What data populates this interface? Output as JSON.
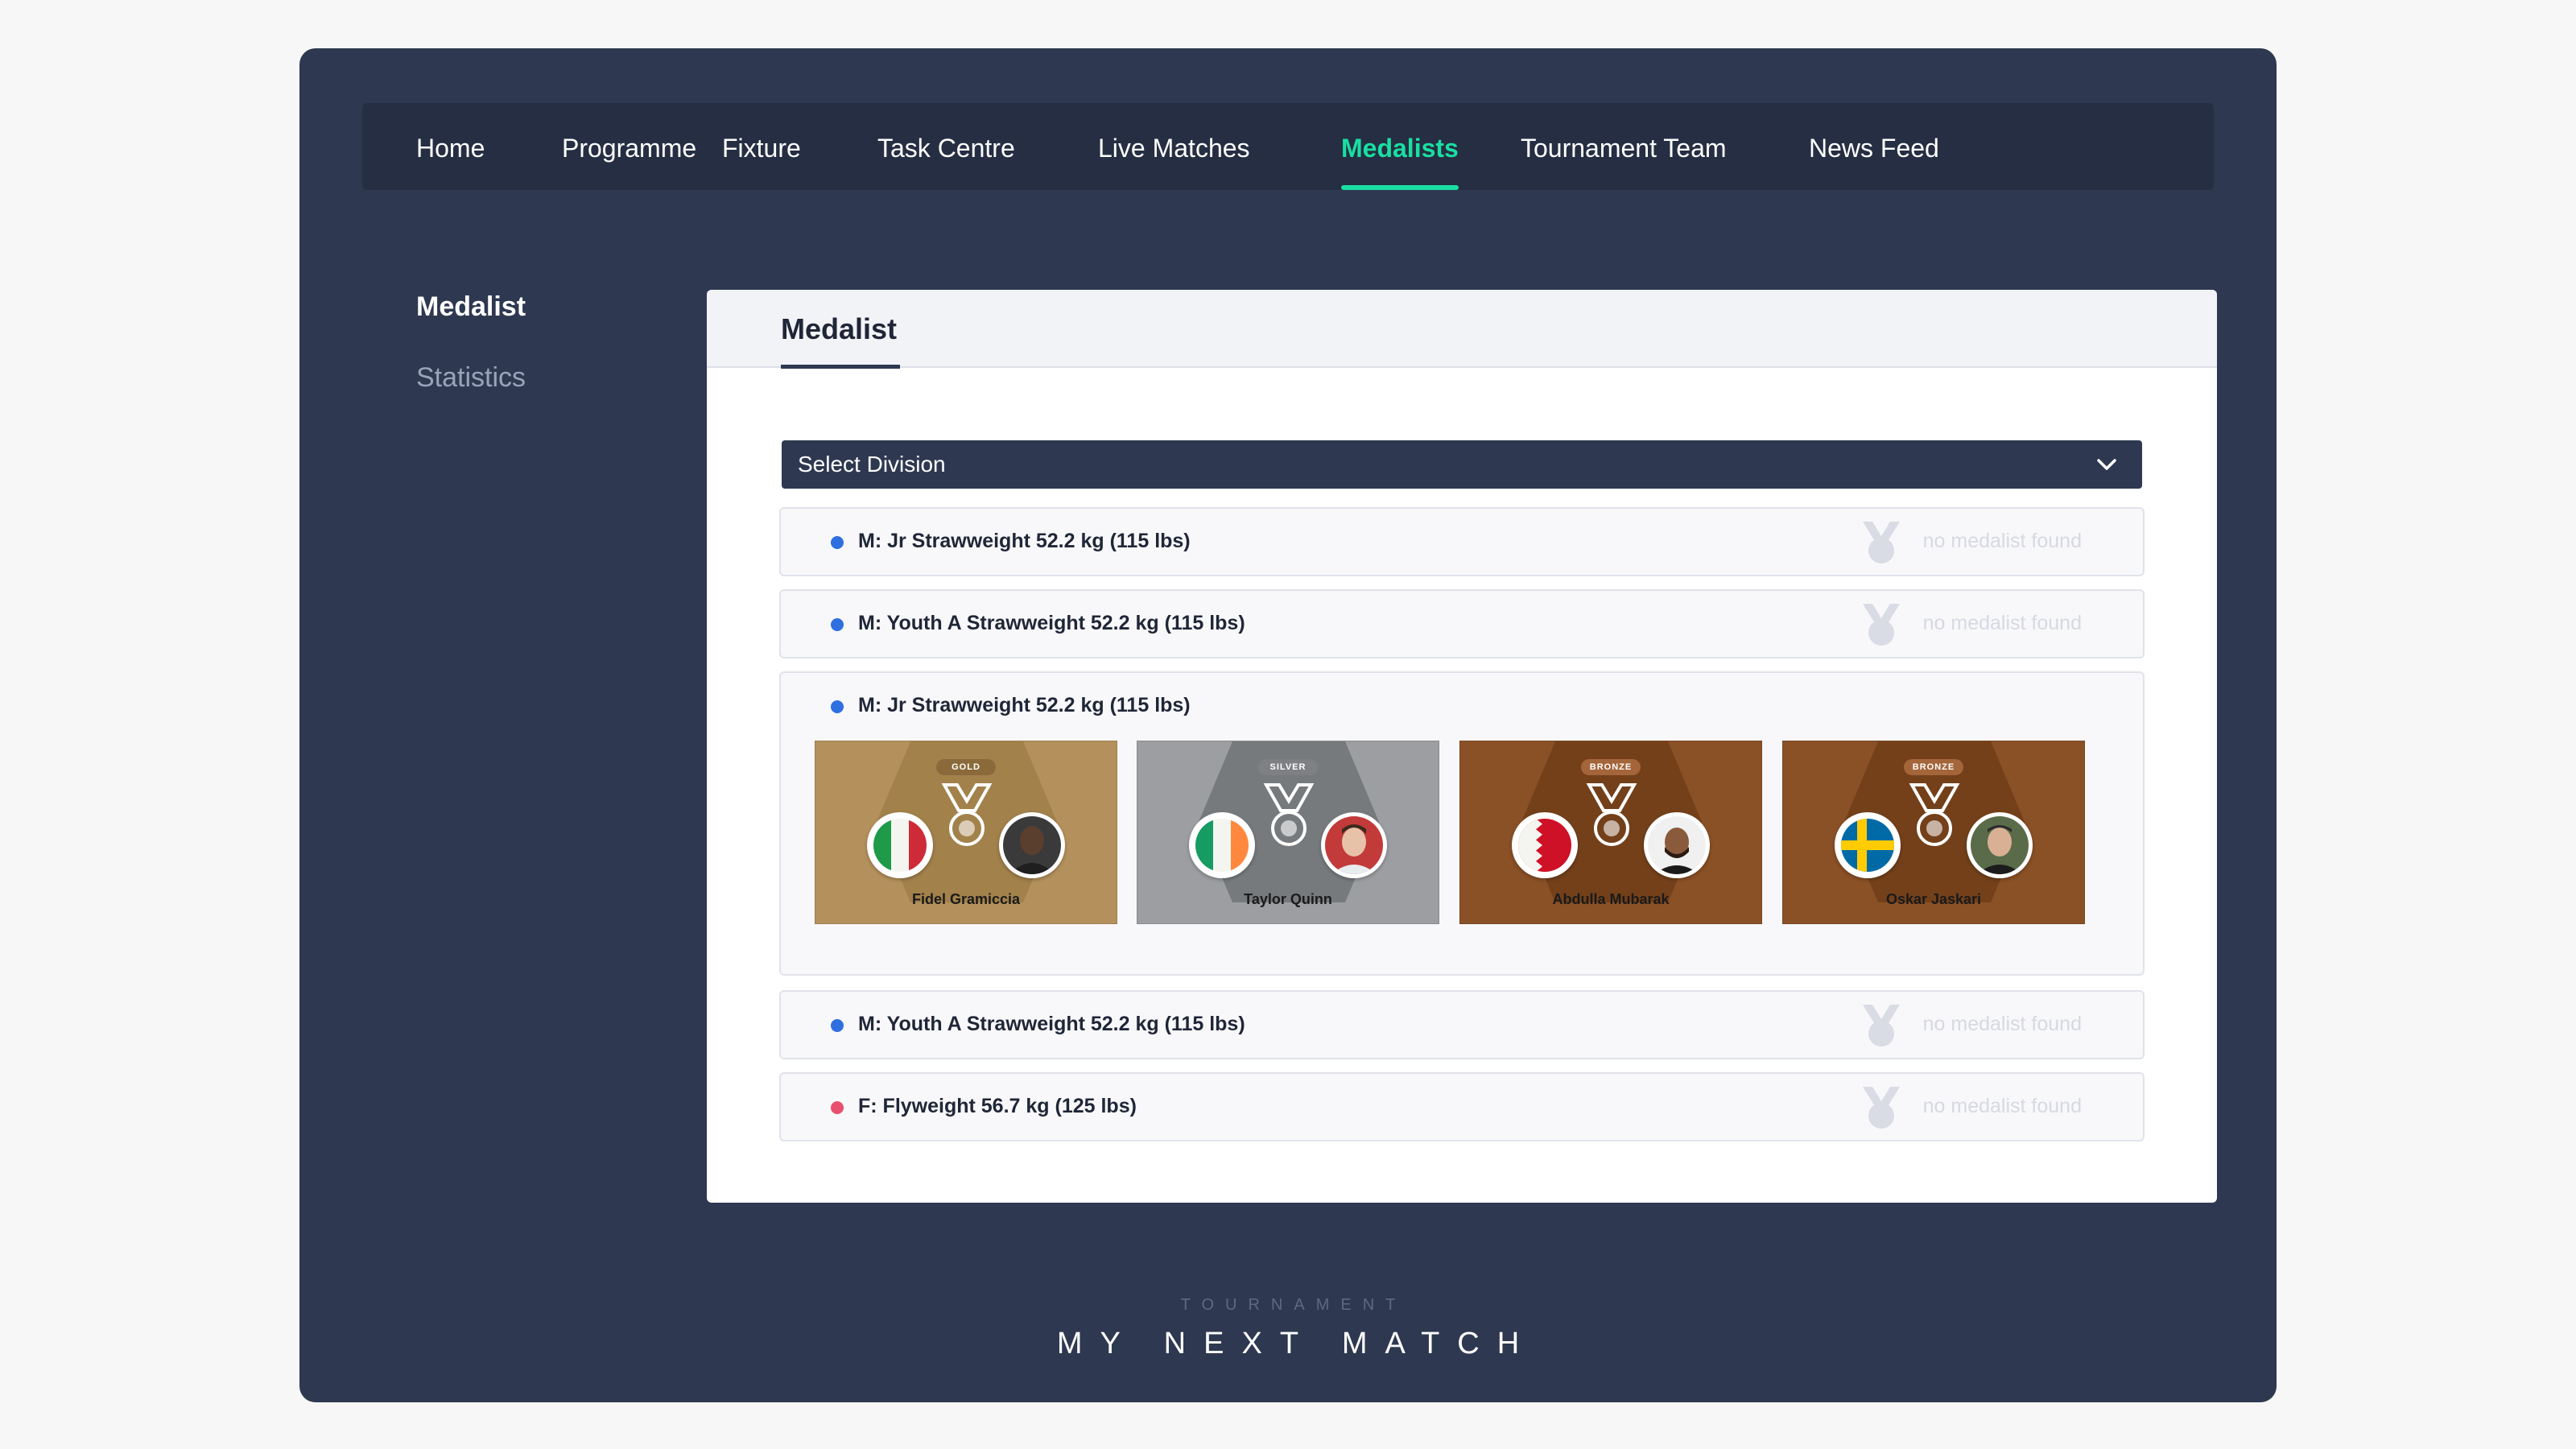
{
  "nav": {
    "items": [
      {
        "label": "Home",
        "active": false
      },
      {
        "label": "Programme",
        "active": false
      },
      {
        "label": "Fixture",
        "active": false
      },
      {
        "label": "Task Centre",
        "active": false
      },
      {
        "label": "Live Matches",
        "active": false
      },
      {
        "label": "Medalists",
        "active": true
      },
      {
        "label": "Tournament Team",
        "active": false
      },
      {
        "label": "News Feed",
        "active": false
      }
    ],
    "accent_color": "#19dfa2"
  },
  "sidebar": {
    "items": [
      {
        "label": "Medalist",
        "active": true
      },
      {
        "label": "Statistics",
        "active": false
      }
    ]
  },
  "panel": {
    "tab_label": "Medalist",
    "select_label": "Select Division",
    "empty_text": "no medalist found",
    "divisions": [
      {
        "label": "M: Jr Strawweight 52.2 kg (115 lbs)",
        "dot_color": "#2f6fe0"
      },
      {
        "label": "M: Youth A Strawweight 52.2 kg (115 lbs)",
        "dot_color": "#2f6fe0"
      },
      {
        "label": "M: Jr Strawweight 52.2 kg (115 lbs)",
        "dot_color": "#2f6fe0"
      },
      {
        "label": "M: Youth A Strawweight 52.2 kg (115 lbs)",
        "dot_color": "#2f6fe0"
      },
      {
        "label": "F: Flyweight 56.7 kg (125 lbs)",
        "dot_color": "#e8506e"
      }
    ],
    "medalists": [
      {
        "rank": "GOLD",
        "name": "Fidel Gramiccia",
        "flag": "italy",
        "color": "#b4915c"
      },
      {
        "rank": "SILVER",
        "name": "Taylor Quinn",
        "flag": "ireland",
        "color": "#9c9ea2"
      },
      {
        "rank": "BRONZE",
        "name": "Abdulla Mubarak",
        "flag": "bahrain",
        "color": "#8a5026"
      },
      {
        "rank": "BRONZE",
        "name": "Oskar Jaskari",
        "flag": "sweden",
        "color": "#8a5026"
      }
    ]
  },
  "footer": {
    "small": "TOURNAMENT",
    "big": "MY NEXT MATCH"
  }
}
